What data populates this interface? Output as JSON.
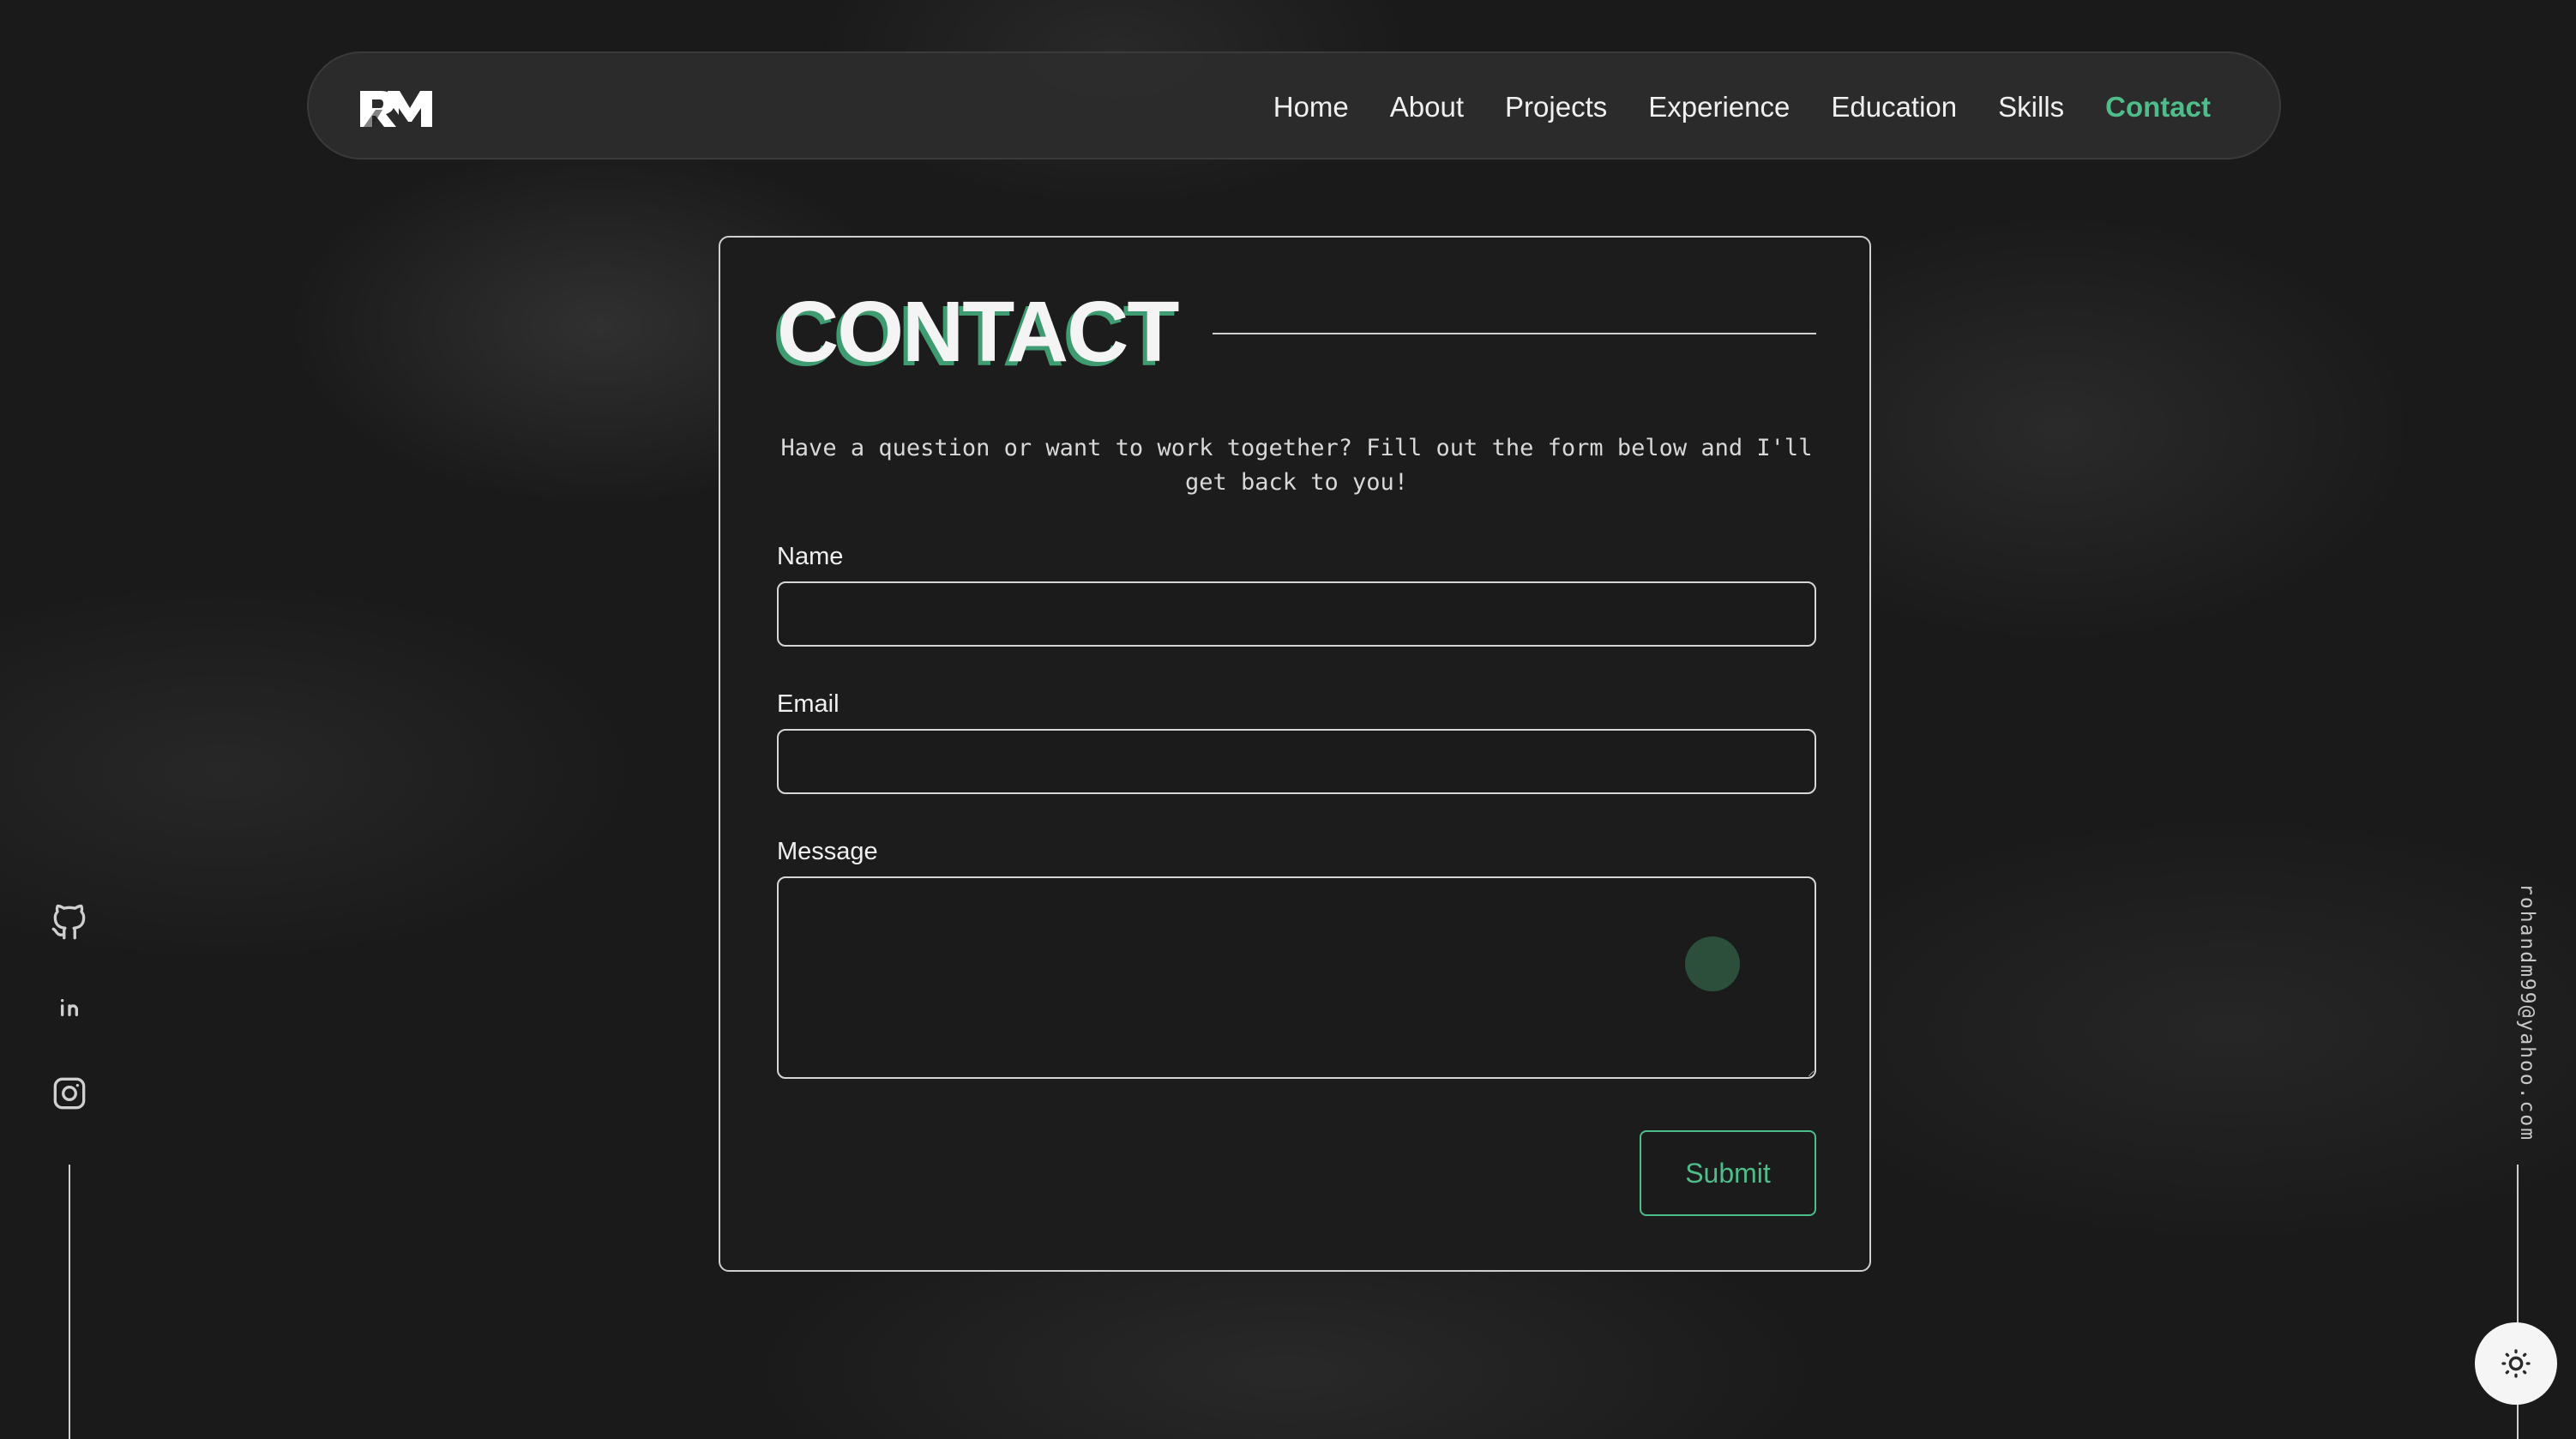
{
  "brand": {
    "logo_text": "RM"
  },
  "nav": {
    "items": [
      {
        "label": "Home",
        "active": false
      },
      {
        "label": "About",
        "active": false
      },
      {
        "label": "Projects",
        "active": false
      },
      {
        "label": "Experience",
        "active": false
      },
      {
        "label": "Education",
        "active": false
      },
      {
        "label": "Skills",
        "active": false
      },
      {
        "label": "Contact",
        "active": true
      }
    ]
  },
  "contact": {
    "title": "CONTACT",
    "intro": "Have a question or want to work together? Fill out the form below and I'll get back to you!",
    "fields": {
      "name": {
        "label": "Name",
        "value": "",
        "placeholder": ""
      },
      "email": {
        "label": "Email",
        "value": "",
        "placeholder": ""
      },
      "message": {
        "label": "Message",
        "value": "",
        "placeholder": ""
      }
    },
    "submit_label": "Submit"
  },
  "social": {
    "icons": [
      "github-icon",
      "linkedin-icon",
      "instagram-icon"
    ]
  },
  "email": "rohandm99@yahoo.com",
  "theme_toggle": {
    "icon": "sun-icon"
  },
  "colors": {
    "accent": "#4ebd8a",
    "background": "#1a1a1a",
    "card_border": "#cfcfcf",
    "title_shadow": "#3f9c70"
  }
}
